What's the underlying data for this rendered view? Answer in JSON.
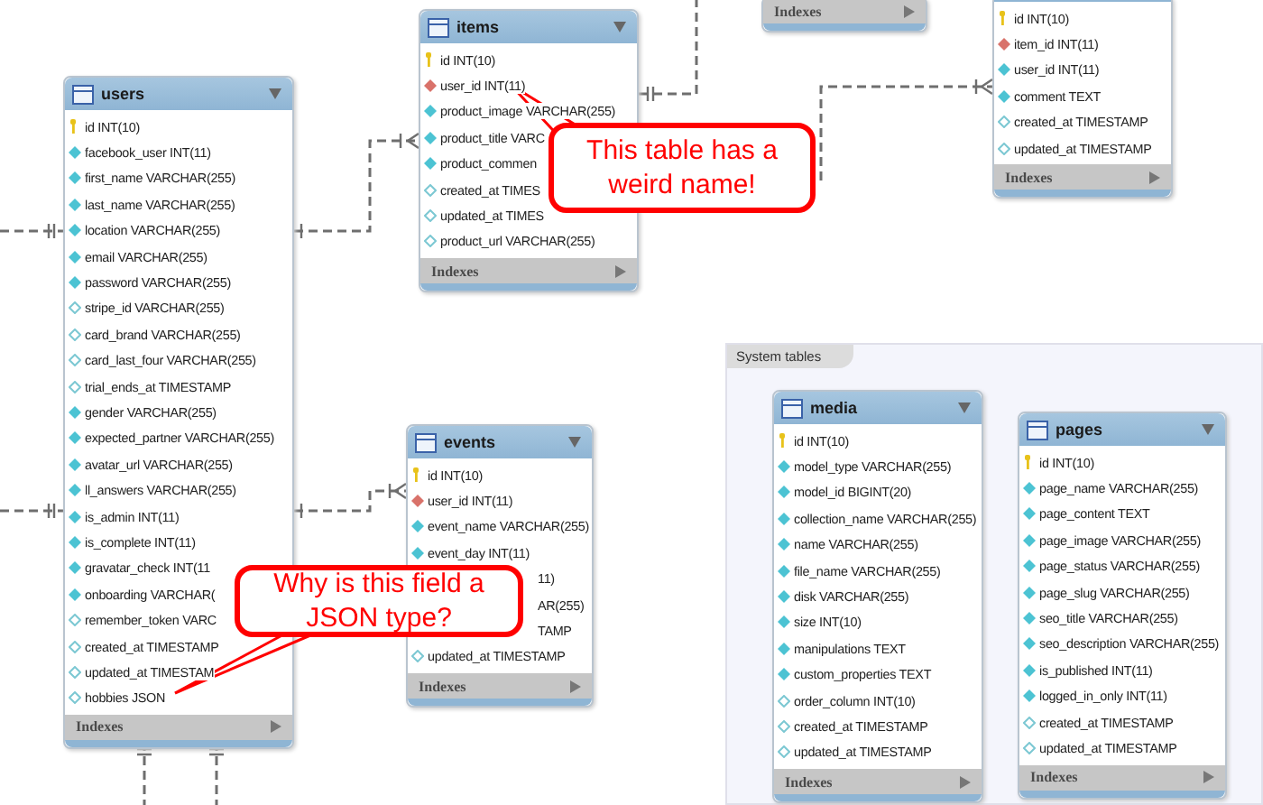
{
  "tables": [
    {
      "footer": "Indexes"
    },
    {
      "columns": [
        {
          "text": "id INT(10)",
          "kind": "pk"
        },
        {
          "text": "item_id INT(11)",
          "kind": "fk"
        },
        {
          "text": "user_id INT(11)",
          "kind": "nn"
        },
        {
          "text": "comment TEXT",
          "kind": "nn"
        },
        {
          "text": "created_at TIMESTAMP",
          "kind": "null"
        },
        {
          "text": "updated_at TIMESTAMP",
          "kind": "null"
        }
      ],
      "footer": "Indexes"
    },
    {
      "name": "items",
      "columns": [
        {
          "text": "id INT(10)",
          "kind": "pk"
        },
        {
          "text": "user_id INT(11)",
          "kind": "fk"
        },
        {
          "text": "product_image VARCHAR(255)",
          "kind": "nn"
        },
        {
          "text": "product_title VARC",
          "kind": "nn"
        },
        {
          "text": "product_commen",
          "kind": "nn"
        },
        {
          "text": "created_at TIMES",
          "kind": "null"
        },
        {
          "text": "updated_at TIMES",
          "kind": "null"
        },
        {
          "text": "product_url VARCHAR(255)",
          "kind": "null"
        }
      ],
      "footer": "Indexes"
    },
    {
      "name": "users",
      "columns": [
        {
          "text": "id INT(10)",
          "kind": "pk"
        },
        {
          "text": "facebook_user INT(11)",
          "kind": "nn"
        },
        {
          "text": "first_name VARCHAR(255)",
          "kind": "nn"
        },
        {
          "text": "last_name VARCHAR(255)",
          "kind": "nn"
        },
        {
          "text": "location VARCHAR(255)",
          "kind": "nn"
        },
        {
          "text": "email VARCHAR(255)",
          "kind": "nn"
        },
        {
          "text": "password VARCHAR(255)",
          "kind": "nn"
        },
        {
          "text": "stripe_id VARCHAR(255)",
          "kind": "null"
        },
        {
          "text": "card_brand VARCHAR(255)",
          "kind": "null"
        },
        {
          "text": "card_last_four VARCHAR(255)",
          "kind": "null"
        },
        {
          "text": "trial_ends_at TIMESTAMP",
          "kind": "null"
        },
        {
          "text": "gender VARCHAR(255)",
          "kind": "nn"
        },
        {
          "text": "expected_partner VARCHAR(255)",
          "kind": "nn"
        },
        {
          "text": "avatar_url VARCHAR(255)",
          "kind": "nn"
        },
        {
          "text": "ll_answers VARCHAR(255)",
          "kind": "nn"
        },
        {
          "text": "is_admin INT(11)",
          "kind": "nn"
        },
        {
          "text": "is_complete INT(11)",
          "kind": "nn"
        },
        {
          "text": "gravatar_check INT(11",
          "kind": "nn"
        },
        {
          "text": "onboarding VARCHAR(",
          "kind": "nn"
        },
        {
          "text": "remember_token VARC",
          "kind": "null"
        },
        {
          "text": "created_at TIMESTAMP",
          "kind": "null"
        },
        {
          "text": "updated_at TIMESTAM",
          "kind": "null"
        },
        {
          "text": "hobbies JSON",
          "kind": "null"
        }
      ],
      "footer": "Indexes"
    },
    {
      "name": "events",
      "columns": [
        {
          "text": "id INT(10)",
          "kind": "pk"
        },
        {
          "text": "user_id INT(11)",
          "kind": "fk"
        },
        {
          "text": "event_name VARCHAR(255)",
          "kind": "nn"
        },
        {
          "text": "event_day INT(11)",
          "kind": "nn"
        },
        {
          "text": "11)",
          "kind": "clipped"
        },
        {
          "text": "AR(255)",
          "kind": "clipped"
        },
        {
          "text": "TAMP",
          "kind": "clipped"
        },
        {
          "text": "updated_at TIMESTAMP",
          "kind": "null"
        }
      ],
      "footer": "Indexes"
    }
  ],
  "layer": {
    "label": "System tables",
    "tables": [
      {
        "name": "media",
        "columns": [
          {
            "text": "id INT(10)",
            "kind": "pk"
          },
          {
            "text": "model_type VARCHAR(255)",
            "kind": "nn"
          },
          {
            "text": "model_id BIGINT(20)",
            "kind": "nn"
          },
          {
            "text": "collection_name VARCHAR(255)",
            "kind": "nn"
          },
          {
            "text": "name VARCHAR(255)",
            "kind": "nn"
          },
          {
            "text": "file_name VARCHAR(255)",
            "kind": "nn"
          },
          {
            "text": "disk VARCHAR(255)",
            "kind": "nn"
          },
          {
            "text": "size INT(10)",
            "kind": "nn"
          },
          {
            "text": "manipulations TEXT",
            "kind": "nn"
          },
          {
            "text": "custom_properties TEXT",
            "kind": "nn"
          },
          {
            "text": "order_column INT(10)",
            "kind": "null"
          },
          {
            "text": "created_at TIMESTAMP",
            "kind": "null"
          },
          {
            "text": "updated_at TIMESTAMP",
            "kind": "null"
          }
        ],
        "footer": "Indexes"
      },
      {
        "name": "pages",
        "columns": [
          {
            "text": "id INT(10)",
            "kind": "pk"
          },
          {
            "text": "page_name VARCHAR(255)",
            "kind": "nn"
          },
          {
            "text": "page_content TEXT",
            "kind": "nn"
          },
          {
            "text": "page_image VARCHAR(255)",
            "kind": "nn"
          },
          {
            "text": "page_status VARCHAR(255)",
            "kind": "nn"
          },
          {
            "text": "page_slug VARCHAR(255)",
            "kind": "nn"
          },
          {
            "text": "seo_title VARCHAR(255)",
            "kind": "nn"
          },
          {
            "text": "seo_description VARCHAR(255)",
            "kind": "nn"
          },
          {
            "text": "is_published INT(11)",
            "kind": "nn"
          },
          {
            "text": "logged_in_only INT(11)",
            "kind": "nn"
          },
          {
            "text": "created_at TIMESTAMP",
            "kind": "null"
          },
          {
            "text": "updated_at TIMESTAMP",
            "kind": "null"
          }
        ],
        "footer": "Indexes"
      }
    ]
  },
  "notes": [
    {
      "text": "This table has a weird name!"
    },
    {
      "text": "Why is this field a JSON type?"
    }
  ]
}
